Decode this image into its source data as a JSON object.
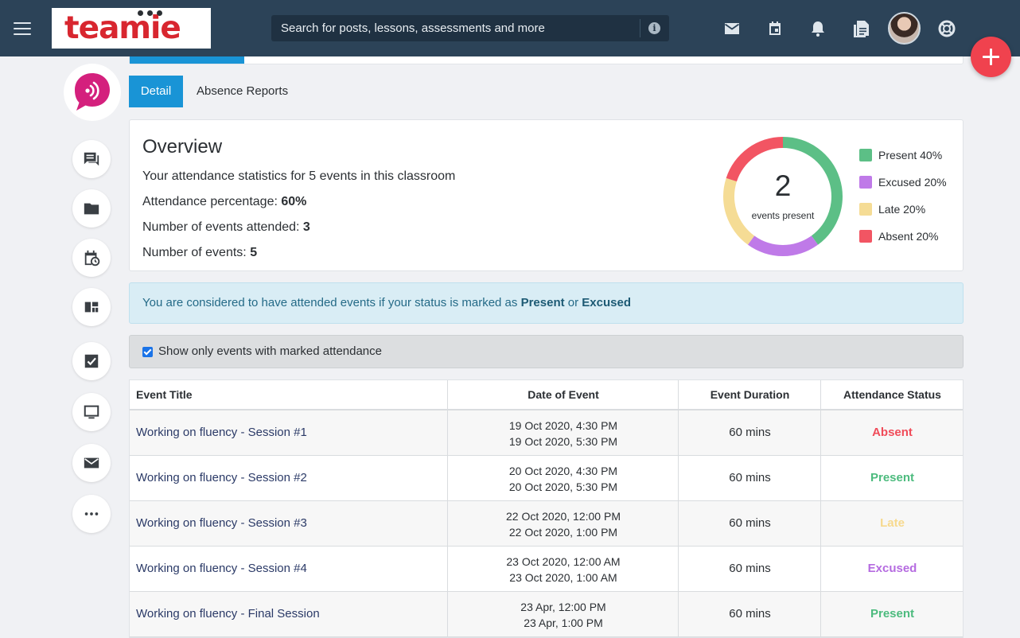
{
  "header": {
    "logo_text": "teamie",
    "search": {
      "placeholder": "Search for posts, lessons, assessments and more"
    }
  },
  "tabs": [
    {
      "label": "Detail",
      "active": true
    },
    {
      "label": "Absence Reports",
      "active": false
    }
  ],
  "overview": {
    "title": "Overview",
    "summary": "Your attendance statistics for 5 events in this classroom",
    "attendance_label": "Attendance percentage:",
    "attendance_value": "60%",
    "attended_label": "Number of events attended:",
    "attended_value": "3",
    "events_label": "Number of events:",
    "events_value": "5",
    "donut_number": "2",
    "donut_caption": "events present"
  },
  "chart_data": {
    "type": "pie",
    "categories": [
      "Present",
      "Excused",
      "Late",
      "Absent"
    ],
    "values": [
      40,
      20,
      20,
      20
    ],
    "labels": [
      "Present 40%",
      "Excused 20%",
      "Late 20%",
      "Absent 20%"
    ],
    "colors": [
      "#5cbf86",
      "#bf7ae8",
      "#f5dc95",
      "#f25563"
    ],
    "legend_position": "right"
  },
  "note": {
    "prefix": "You are considered to have attended events if your status is marked as",
    "present": "Present",
    "or": "or",
    "excused": "Excused"
  },
  "filter": {
    "label": "Show only events with marked attendance",
    "checked": true
  },
  "table": {
    "headers": [
      "Event Title",
      "Date of Event",
      "Event Duration",
      "Attendance Status"
    ],
    "rows": [
      {
        "title": "Working on fluency - Session #1",
        "start": "19 Oct 2020, 4:30 PM",
        "end": "19 Oct 2020, 5:30 PM",
        "duration": "60 mins",
        "status": "Absent"
      },
      {
        "title": "Working on fluency - Session #2",
        "start": "20 Oct 2020, 4:30 PM",
        "end": "20 Oct 2020, 5:30 PM",
        "duration": "60 mins",
        "status": "Present"
      },
      {
        "title": "Working on fluency - Session #3",
        "start": "22 Oct 2020, 12:00 PM",
        "end": "22 Oct 2020, 1:00 PM",
        "duration": "60 mins",
        "status": "Late"
      },
      {
        "title": "Working on fluency - Session #4",
        "start": "23 Oct 2020, 12:00 AM",
        "end": "23 Oct 2020, 1:00 AM",
        "duration": "60 mins",
        "status": "Excused"
      },
      {
        "title": "Working on fluency - Final Session",
        "start": "23 Apr, 12:00 PM",
        "end": "23 Apr, 1:00 PM",
        "duration": "60 mins",
        "status": "Present"
      }
    ]
  },
  "status_colors": {
    "Absent": "#f04b59",
    "Present": "#4dbb7e",
    "Late": "#f7d98d",
    "Excused": "#b56be0"
  },
  "colors": {
    "header_bg": "#2c4358",
    "accent": "#1994d6",
    "fab": "#f0424e"
  }
}
